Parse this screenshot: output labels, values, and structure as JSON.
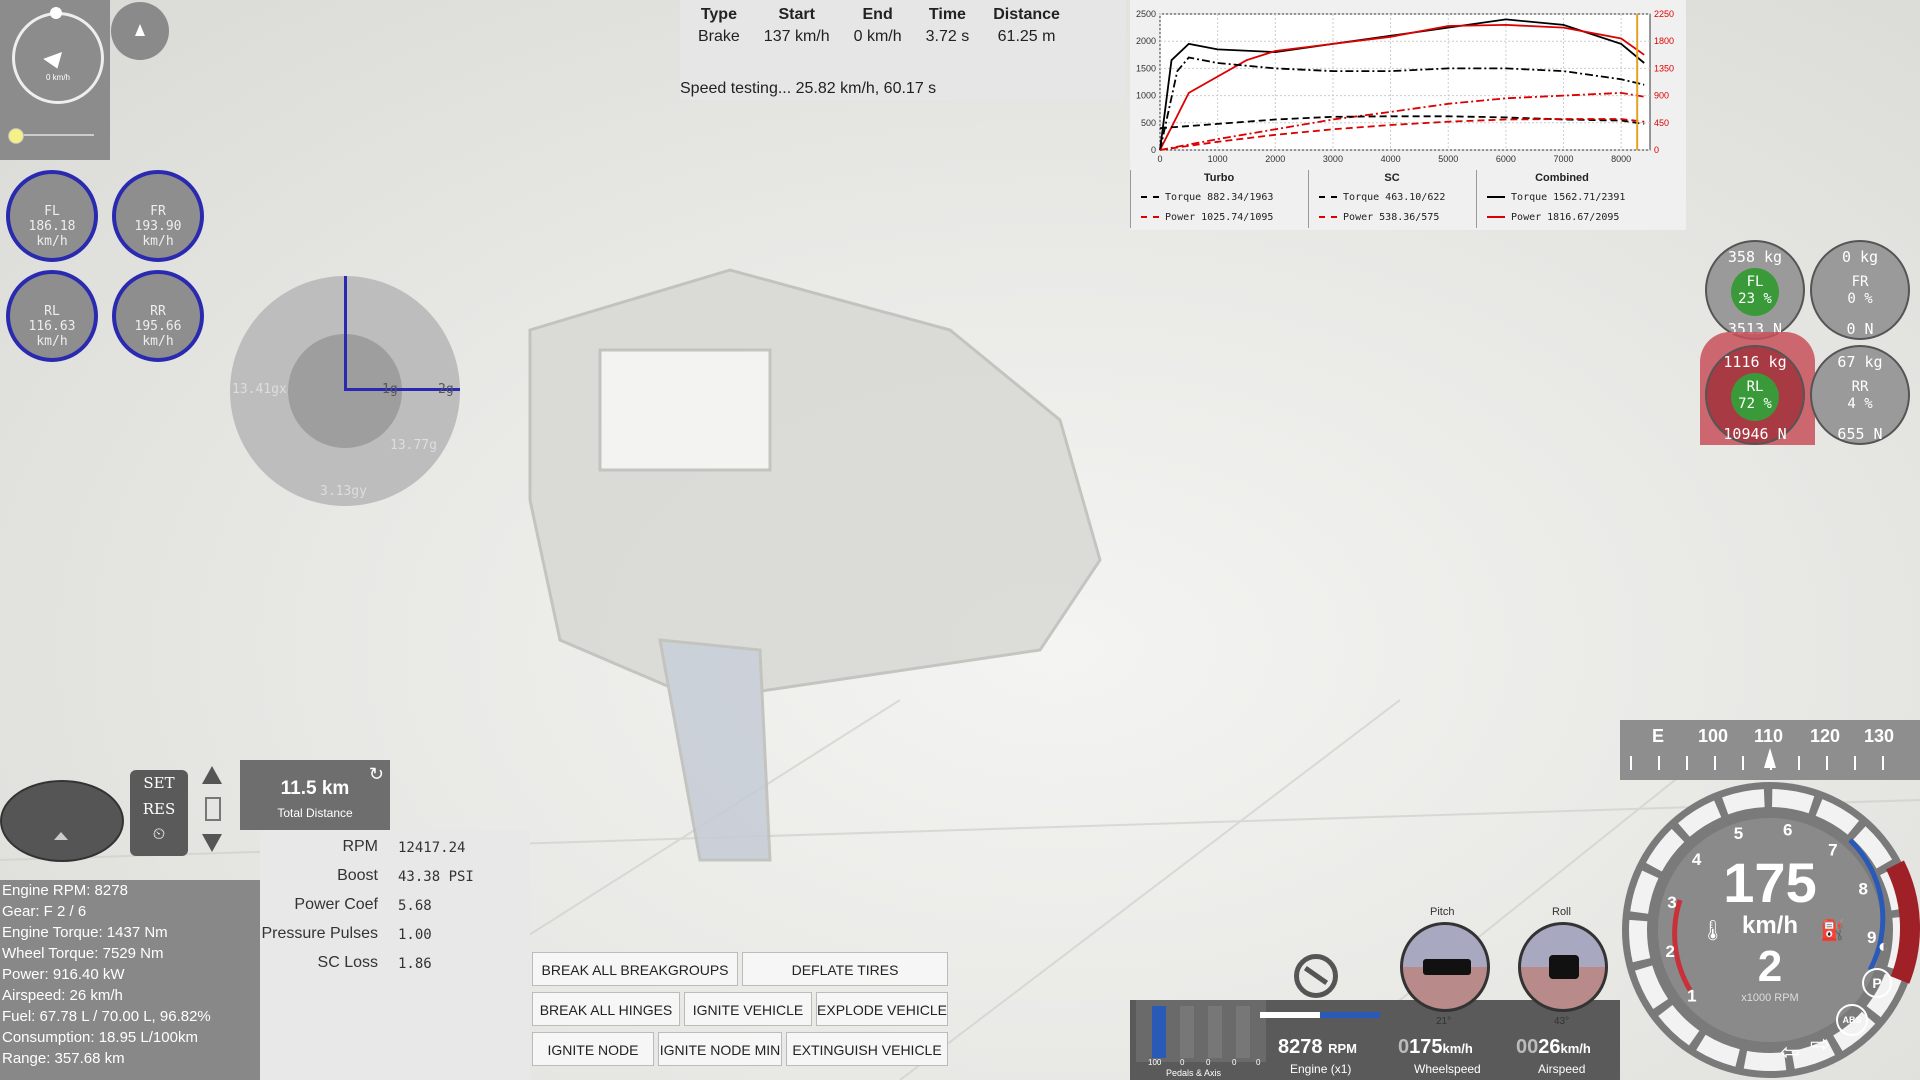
{
  "compass": {
    "speed_label": "0 km/h"
  },
  "wheels": [
    {
      "name": "FL",
      "speed": "186.18 km/h"
    },
    {
      "name": "FR",
      "speed": "193.90 km/h"
    },
    {
      "name": "RL",
      "speed": "116.63 km/h"
    },
    {
      "name": "RR",
      "speed": "195.66 km/h"
    }
  ],
  "gmeter": {
    "x_label": "13.41gx",
    "y_label": "3.13gy",
    "z_label": "13.77g",
    "tick_1": "1g",
    "tick_2": "2g"
  },
  "brake_test": {
    "headers": [
      "Type",
      "Start",
      "End",
      "Time",
      "Distance"
    ],
    "row": [
      "Brake",
      "137 km/h",
      "0 km/h",
      "3.72 s",
      "61.25 m"
    ],
    "status": "Speed testing... 25.82 km/h, 60.17 s"
  },
  "chart_data": {
    "type": "line",
    "x_ticks": [
      "0",
      "1000",
      "2000",
      "3000",
      "4000",
      "5000",
      "6000",
      "7000",
      "8000"
    ],
    "y_left_ticks": [
      "0",
      "500",
      "1000",
      "1500",
      "2000",
      "2500"
    ],
    "y_right_ticks": [
      "0",
      "450",
      "900",
      "1350",
      "1800",
      "2250"
    ],
    "groups": [
      {
        "title": "Turbo",
        "torque": "Torque 882.34/1963",
        "power": "Power 1025.74/1095"
      },
      {
        "title": "SC",
        "torque": "Torque 463.10/622",
        "power": "Power 538.36/575"
      },
      {
        "title": "Combined",
        "torque": "Torque 1562.71/2391",
        "power": "Power 1816.67/2095"
      }
    ],
    "series": [
      {
        "values": [
          [
            0,
            0
          ],
          [
            200,
            1650
          ],
          [
            500,
            1950
          ],
          [
            1000,
            1850
          ],
          [
            2000,
            1800
          ],
          [
            3000,
            1950
          ],
          [
            4000,
            2100
          ],
          [
            5000,
            2250
          ],
          [
            6000,
            2400
          ],
          [
            7000,
            2300
          ],
          [
            8000,
            1950
          ],
          [
            8400,
            1600
          ]
        ]
      },
      {
        "values": [
          [
            0,
            0
          ],
          [
            500,
            1050
          ],
          [
            1500,
            1650
          ],
          [
            2000,
            1820
          ],
          [
            3000,
            1950
          ],
          [
            4000,
            2080
          ],
          [
            5000,
            2280
          ],
          [
            6000,
            2300
          ],
          [
            7000,
            2250
          ],
          [
            8000,
            2050
          ],
          [
            8400,
            1750
          ]
        ]
      },
      {
        "values": [
          [
            0,
            0
          ],
          [
            300,
            1450
          ],
          [
            500,
            1700
          ],
          [
            1000,
            1600
          ],
          [
            2000,
            1500
          ],
          [
            3000,
            1450
          ],
          [
            4000,
            1450
          ],
          [
            5000,
            1500
          ],
          [
            6000,
            1500
          ],
          [
            7000,
            1450
          ],
          [
            8000,
            1300
          ],
          [
            8400,
            1200
          ]
        ]
      },
      {
        "values": [
          [
            0,
            0
          ],
          [
            1000,
            200
          ],
          [
            2000,
            380
          ],
          [
            3000,
            560
          ],
          [
            4000,
            700
          ],
          [
            5000,
            850
          ],
          [
            6000,
            950
          ],
          [
            7000,
            1000
          ],
          [
            8000,
            1050
          ],
          [
            8400,
            980
          ]
        ]
      },
      {
        "values": [
          [
            0,
            400
          ],
          [
            1000,
            480
          ],
          [
            2000,
            560
          ],
          [
            3000,
            610
          ],
          [
            4000,
            620
          ],
          [
            5000,
            620
          ],
          [
            6000,
            600
          ],
          [
            7000,
            560
          ],
          [
            8000,
            540
          ],
          [
            8400,
            480
          ]
        ]
      },
      {
        "values": [
          [
            0,
            0
          ],
          [
            1000,
            150
          ],
          [
            2000,
            280
          ],
          [
            3000,
            380
          ],
          [
            4000,
            460
          ],
          [
            5000,
            520
          ],
          [
            6000,
            560
          ],
          [
            7000,
            570
          ],
          [
            8000,
            570
          ],
          [
            8400,
            520
          ]
        ]
      }
    ]
  },
  "tires": [
    {
      "id": "FL",
      "mass": "358 kg",
      "pct": "23 %",
      "force": "3513 N",
      "hot": false,
      "inner": "#3a9a3a"
    },
    {
      "id": "FR",
      "mass": "0 kg",
      "pct": "0 %",
      "force": "0 N",
      "hot": false,
      "inner": "#9a9a9a"
    },
    {
      "id": "RL",
      "mass": "1116 kg",
      "pct": "72 %",
      "force": "10946 N",
      "hot": true,
      "inner": "#3a9a3a"
    },
    {
      "id": "RR",
      "mass": "67 kg",
      "pct": "4 %",
      "force": "655 N",
      "hot": false,
      "inner": "#9a9a9a"
    }
  ],
  "cruise": {
    "set": "SET",
    "res": "RES"
  },
  "distance": {
    "value": "11.5 km",
    "label": "Total Distance"
  },
  "engine_info": [
    "Engine RPM: 8278",
    "Gear: F 2 / 6",
    "Engine Torque: 1437 Nm",
    "Wheel Torque: 7529 Nm",
    "Power: 916.40 kW",
    "Airspeed: 26 km/h",
    "Fuel: 67.78 L / 70.00 L, 96.82%",
    "Consumption: 18.95 L/100km",
    "Range: 357.68 km"
  ],
  "turbo_stats": [
    {
      "label": "RPM",
      "value": "12417.24"
    },
    {
      "label": "Boost",
      "value": "43.38 PSI"
    },
    {
      "label": "Power Coef",
      "value": "5.68"
    },
    {
      "label": "Pressure Pulses",
      "value": "1.00"
    },
    {
      "label": "SC Loss",
      "value": "1.86"
    }
  ],
  "buttons": {
    "break_groups": "BREAK ALL BREAKGROUPS",
    "deflate": "DEFLATE TIRES",
    "break_hinges": "BREAK ALL HINGES",
    "ignite_vehicle": "IGNITE VEHICLE",
    "explode": "EXPLODE VEHICLE",
    "ignite_node": "IGNITE NODE",
    "ignite_node_min": "IGNITE NODE MIN",
    "extinguish": "EXTINGUISH VEHICLE"
  },
  "pedals": {
    "label": "Pedals & Axis",
    "val_100": "100",
    "v0a": "0",
    "v0b": "0",
    "v0c": "0",
    "v0d": "0"
  },
  "readouts": {
    "rpm_value": "8278",
    "rpm_unit": "RPM",
    "rpm_label": "Engine (x1)",
    "wheel_prefix": "0",
    "wheel_value": "175",
    "wheel_unit": "km/h",
    "wheel_label": "Wheelspeed",
    "air_prefix": "00",
    "air_value": "26",
    "air_unit": "km/h",
    "air_label": "Airspeed"
  },
  "attitude": {
    "pitch_label": "Pitch",
    "pitch_value": "21°",
    "roll_label": "Roll",
    "roll_value": "43°"
  },
  "heading_tape": {
    "e": "E",
    "t100": "100",
    "t110": "110",
    "t120": "120",
    "t130": "130"
  },
  "speedo": {
    "speed": "175",
    "unit": "km/h",
    "gear": "2",
    "rpm_label": "x1000 RPM",
    "ticks": [
      "1",
      "2",
      "3",
      "4",
      "5",
      "6",
      "7",
      "8",
      "9"
    ],
    "abs": "ABS",
    "parking": "P"
  },
  "colors": {
    "accent_blue": "#2a2ab0",
    "hot_red": "#c8303a",
    "ok_green": "#3a9a3a"
  }
}
